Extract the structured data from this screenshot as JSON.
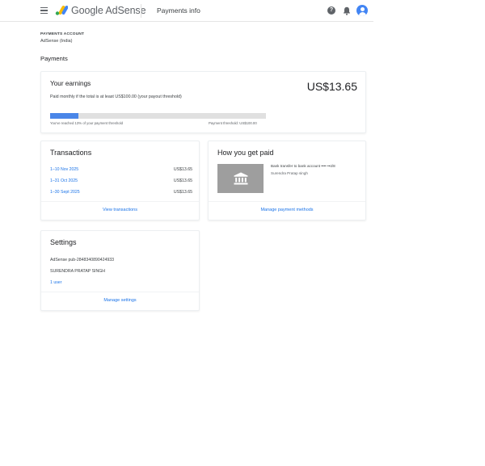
{
  "header": {
    "brand": "Google AdSense",
    "page_title": "Payments info",
    "help_icon_glyph": "?",
    "icons": [
      "menu-icon",
      "adsense-logo-icon",
      "help-icon",
      "bell-icon",
      "avatar"
    ],
    "accent_color": "#1a73e8"
  },
  "account": {
    "label": "PAYMENTS ACCOUNT",
    "name": "AdSense (India)"
  },
  "section_title": "Payments",
  "earnings": {
    "title": "Your earnings",
    "amount": "US$13.65",
    "description": "Paid monthly if the total is at least US$100.00 (your payout threshold)",
    "progress_percent": 13,
    "progress_left_label": "You've reached 13% of your payment threshold",
    "progress_right_label": "Payment threshold: US$100.00"
  },
  "transactions": {
    "title": "Transactions",
    "rows": [
      {
        "date": "1–10 Nov 2025",
        "amount": "US$13.65"
      },
      {
        "date": "1–31 Oct 2025",
        "amount": "US$13.65"
      },
      {
        "date": "1–30 Sept 2025",
        "amount": "US$13.65"
      }
    ],
    "link": "View transactions"
  },
  "how_paid": {
    "title": "How you get paid",
    "method": "Bank transfer to bank account •••• ••4/8",
    "holder": "Surendra Pratap singh",
    "icon": "bank-icon",
    "link": "Manage payment methods"
  },
  "settings": {
    "title": "Settings",
    "publisher_id": "AdSense pub-2848340890424933",
    "name": "SURENDRA PRATAP SINGH",
    "users": "1 user",
    "link": "Manage settings"
  }
}
